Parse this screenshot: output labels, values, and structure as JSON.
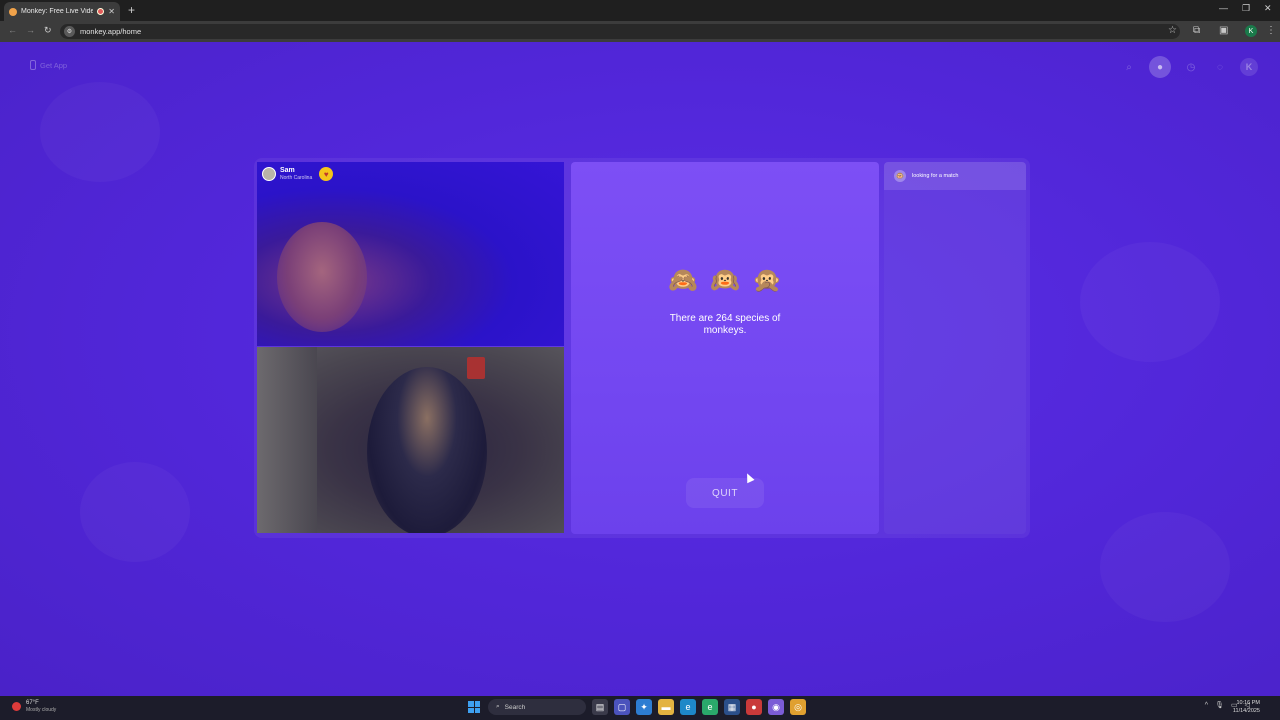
{
  "browser": {
    "tab_title": "Monkey: Free Live Video Ch",
    "url": "monkey.app/home",
    "profile_initial": "K",
    "site_icon": "⚙"
  },
  "page": {
    "get_app_label": "Get App",
    "avatar_initial": "K",
    "fact_text": "There are 264 species of monkeys.",
    "monkey_emojis": [
      "🙈",
      "🙉",
      "🙊"
    ],
    "quit_label": "QUIT",
    "match_status": "looking for a match"
  },
  "remote_user": {
    "name": "Sam",
    "location": "North Carolina"
  },
  "taskbar": {
    "temperature": "67°F",
    "weather": "Mostly cloudy",
    "search_placeholder": "Search",
    "time": "10:16 PM",
    "date": "11/14/2025"
  },
  "colors": {
    "page_background": "#5126d8",
    "center_card": "#7a4cf4"
  }
}
